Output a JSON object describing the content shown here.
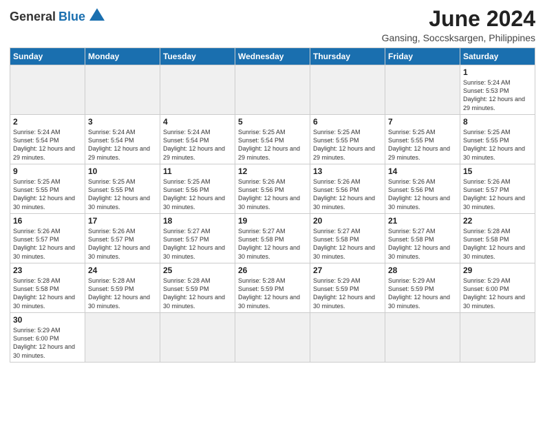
{
  "logo": {
    "general": "General",
    "blue": "Blue"
  },
  "title": "June 2024",
  "location": "Gansing, Soccsksargen, Philippines",
  "days_of_week": [
    "Sunday",
    "Monday",
    "Tuesday",
    "Wednesday",
    "Thursday",
    "Friday",
    "Saturday"
  ],
  "weeks": [
    [
      {
        "day": "",
        "empty": true
      },
      {
        "day": "",
        "empty": true
      },
      {
        "day": "",
        "empty": true
      },
      {
        "day": "",
        "empty": true
      },
      {
        "day": "",
        "empty": true
      },
      {
        "day": "",
        "empty": true
      },
      {
        "day": "1",
        "sunrise": "5:24 AM",
        "sunset": "5:53 PM",
        "daylight": "12 hours and 29 minutes."
      }
    ],
    [
      {
        "day": "2",
        "sunrise": "5:24 AM",
        "sunset": "5:54 PM",
        "daylight": "12 hours and 29 minutes."
      },
      {
        "day": "3",
        "sunrise": "5:24 AM",
        "sunset": "5:54 PM",
        "daylight": "12 hours and 29 minutes."
      },
      {
        "day": "4",
        "sunrise": "5:24 AM",
        "sunset": "5:54 PM",
        "daylight": "12 hours and 29 minutes."
      },
      {
        "day": "5",
        "sunrise": "5:25 AM",
        "sunset": "5:54 PM",
        "daylight": "12 hours and 29 minutes."
      },
      {
        "day": "6",
        "sunrise": "5:25 AM",
        "sunset": "5:55 PM",
        "daylight": "12 hours and 29 minutes."
      },
      {
        "day": "7",
        "sunrise": "5:25 AM",
        "sunset": "5:55 PM",
        "daylight": "12 hours and 29 minutes."
      },
      {
        "day": "8",
        "sunrise": "5:25 AM",
        "sunset": "5:55 PM",
        "daylight": "12 hours and 30 minutes."
      }
    ],
    [
      {
        "day": "9",
        "sunrise": "5:25 AM",
        "sunset": "5:55 PM",
        "daylight": "12 hours and 30 minutes."
      },
      {
        "day": "10",
        "sunrise": "5:25 AM",
        "sunset": "5:55 PM",
        "daylight": "12 hours and 30 minutes."
      },
      {
        "day": "11",
        "sunrise": "5:25 AM",
        "sunset": "5:56 PM",
        "daylight": "12 hours and 30 minutes."
      },
      {
        "day": "12",
        "sunrise": "5:26 AM",
        "sunset": "5:56 PM",
        "daylight": "12 hours and 30 minutes."
      },
      {
        "day": "13",
        "sunrise": "5:26 AM",
        "sunset": "5:56 PM",
        "daylight": "12 hours and 30 minutes."
      },
      {
        "day": "14",
        "sunrise": "5:26 AM",
        "sunset": "5:56 PM",
        "daylight": "12 hours and 30 minutes."
      },
      {
        "day": "15",
        "sunrise": "5:26 AM",
        "sunset": "5:57 PM",
        "daylight": "12 hours and 30 minutes."
      }
    ],
    [
      {
        "day": "16",
        "sunrise": "5:26 AM",
        "sunset": "5:57 PM",
        "daylight": "12 hours and 30 minutes."
      },
      {
        "day": "17",
        "sunrise": "5:26 AM",
        "sunset": "5:57 PM",
        "daylight": "12 hours and 30 minutes."
      },
      {
        "day": "18",
        "sunrise": "5:27 AM",
        "sunset": "5:57 PM",
        "daylight": "12 hours and 30 minutes."
      },
      {
        "day": "19",
        "sunrise": "5:27 AM",
        "sunset": "5:58 PM",
        "daylight": "12 hours and 30 minutes."
      },
      {
        "day": "20",
        "sunrise": "5:27 AM",
        "sunset": "5:58 PM",
        "daylight": "12 hours and 30 minutes."
      },
      {
        "day": "21",
        "sunrise": "5:27 AM",
        "sunset": "5:58 PM",
        "daylight": "12 hours and 30 minutes."
      },
      {
        "day": "22",
        "sunrise": "5:28 AM",
        "sunset": "5:58 PM",
        "daylight": "12 hours and 30 minutes."
      }
    ],
    [
      {
        "day": "23",
        "sunrise": "5:28 AM",
        "sunset": "5:58 PM",
        "daylight": "12 hours and 30 minutes."
      },
      {
        "day": "24",
        "sunrise": "5:28 AM",
        "sunset": "5:59 PM",
        "daylight": "12 hours and 30 minutes."
      },
      {
        "day": "25",
        "sunrise": "5:28 AM",
        "sunset": "5:59 PM",
        "daylight": "12 hours and 30 minutes."
      },
      {
        "day": "26",
        "sunrise": "5:28 AM",
        "sunset": "5:59 PM",
        "daylight": "12 hours and 30 minutes."
      },
      {
        "day": "27",
        "sunrise": "5:29 AM",
        "sunset": "5:59 PM",
        "daylight": "12 hours and 30 minutes."
      },
      {
        "day": "28",
        "sunrise": "5:29 AM",
        "sunset": "5:59 PM",
        "daylight": "12 hours and 30 minutes."
      },
      {
        "day": "29",
        "sunrise": "5:29 AM",
        "sunset": "6:00 PM",
        "daylight": "12 hours and 30 minutes."
      }
    ],
    [
      {
        "day": "30",
        "sunrise": "5:29 AM",
        "sunset": "6:00 PM",
        "daylight": "12 hours and 30 minutes."
      },
      {
        "day": "",
        "empty": true
      },
      {
        "day": "",
        "empty": true
      },
      {
        "day": "",
        "empty": true
      },
      {
        "day": "",
        "empty": true
      },
      {
        "day": "",
        "empty": true
      },
      {
        "day": "",
        "empty": true
      }
    ]
  ]
}
